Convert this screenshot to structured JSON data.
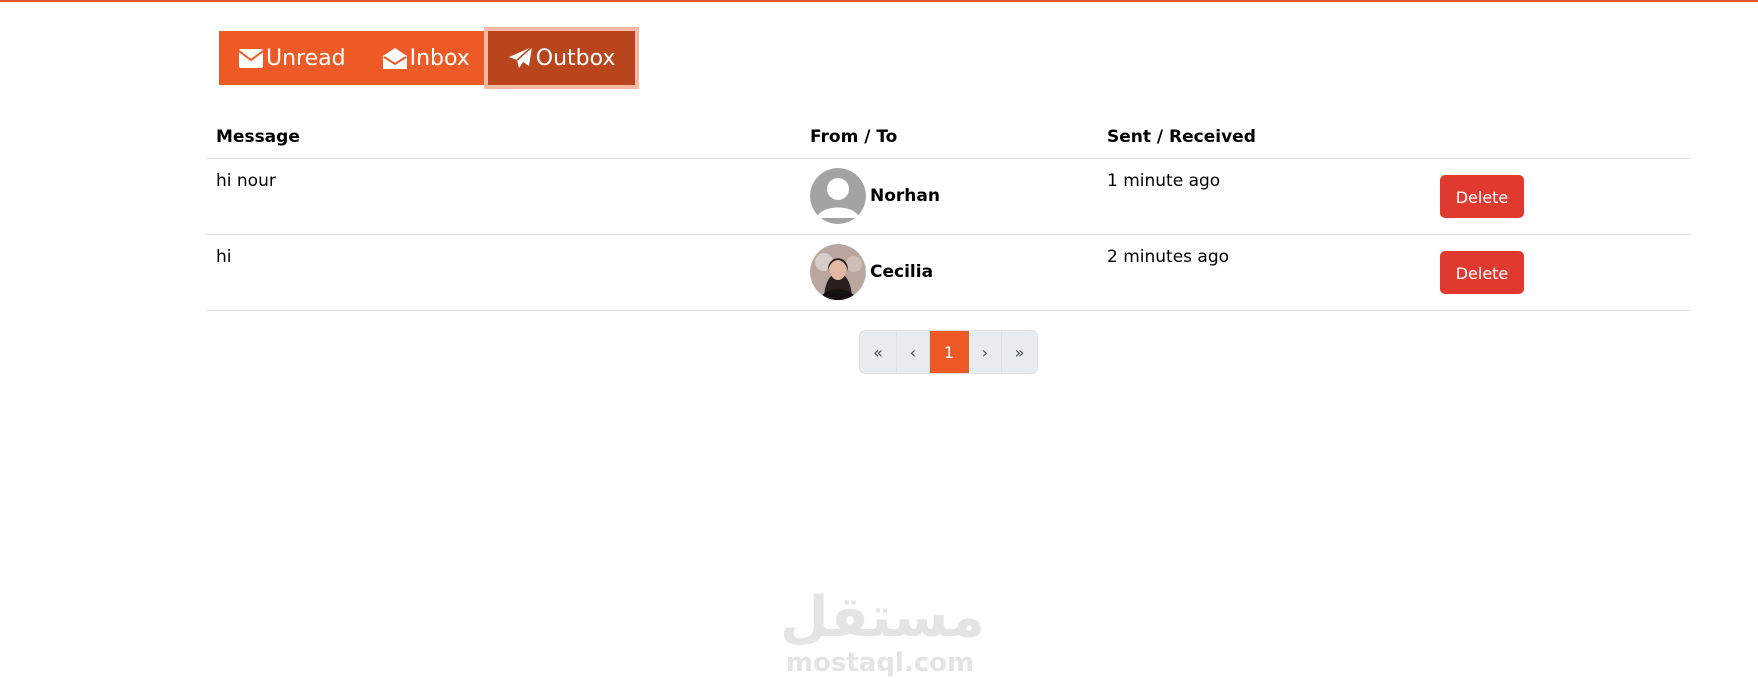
{
  "tabs": [
    {
      "label": "Unread",
      "icon": "envelope-icon",
      "active": false
    },
    {
      "label": "Inbox",
      "icon": "envelope-open-icon",
      "active": false
    },
    {
      "label": "Outbox",
      "icon": "paper-plane-icon",
      "active": true
    }
  ],
  "table": {
    "headers": {
      "message": "Message",
      "from_to": "From / To",
      "sent_received": "Sent / Received"
    },
    "rows": [
      {
        "message": "hi nour",
        "person": "Norhan",
        "avatar": "default-avatar",
        "time": "1 minute ago",
        "action": "Delete"
      },
      {
        "message": "hi",
        "person": "Cecilia",
        "avatar": "photo-avatar",
        "time": "2 minutes ago",
        "action": "Delete"
      }
    ]
  },
  "pagination": {
    "first": "«",
    "prev": "‹",
    "current": "1",
    "next": "›",
    "last": "»"
  },
  "watermark": {
    "arabic": "مستقل",
    "latin": "mostaql.com"
  },
  "colors": {
    "accent": "#ee5a25",
    "active_tab": "#b9451c",
    "danger": "#e03a30",
    "top_line": "#e8552a"
  }
}
